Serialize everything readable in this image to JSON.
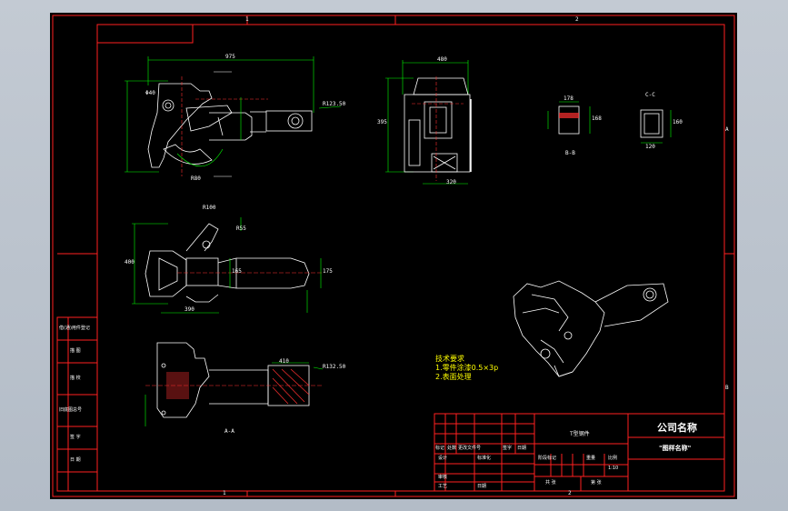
{
  "sheet": {
    "zone_top": [
      "1",
      "2"
    ],
    "zone_bottom": [
      "1",
      "2"
    ],
    "zone_right": [
      "A",
      "B"
    ]
  },
  "dimensions": {
    "top_view_width": "975",
    "top_view_radius": "R123.50",
    "front_view_width": "480",
    "front_view_height": "395",
    "front_view_bottom": "320",
    "section_b_width": "178",
    "section_b_height": "168",
    "section_c_width": "120",
    "section_c_height": "160",
    "side_view_height": "400",
    "side_view_bottom": "390",
    "side_view_right": "175",
    "side_view_mid": "165",
    "lower_view_radius": "R132.50",
    "lower_view_width": "410",
    "r100": "R100",
    "r55": "R55",
    "r80": "R80",
    "phi40": "Φ40"
  },
  "section_labels": {
    "b_b": "B-B",
    "c_c": "C-C",
    "a_a": "A-A"
  },
  "notes": "技术要求\n1.零件涂漆0.5×3p\n2.表面处理",
  "title_block": {
    "company": "公司名称",
    "drawing_name": "\"图样名称\"",
    "part_name": "T型钢件",
    "scale": "1:10",
    "left_column": [
      "借(通)用件登记",
      "描 图",
      "描 校",
      "旧底图总号",
      "签 字",
      "日 期"
    ],
    "row_labels": [
      "标记",
      "处数",
      "更改文件号",
      "签字",
      "日期"
    ],
    "design": "设计",
    "standard": "标准化",
    "check": "审核",
    "process": "工艺",
    "approve": "日期",
    "stage": "阶段标记",
    "weight": "重量",
    "ratio": "比例",
    "sheets": "共 张",
    "sheet_no": "第 张"
  }
}
